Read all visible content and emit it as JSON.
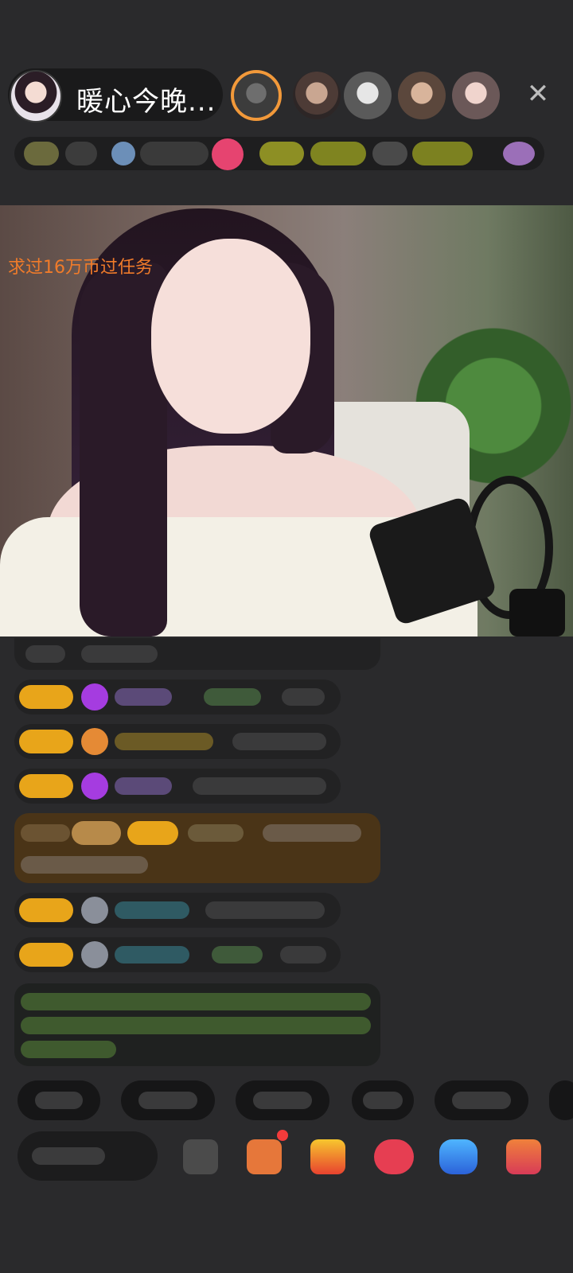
{
  "header": {
    "host_name": "暖心今晚..."
  },
  "video": {
    "overlay_text": "求过16万币过任务"
  },
  "icons": {
    "close": "close-icon"
  },
  "colors": {
    "background": "#2a2a2c",
    "overlay_text": "#f07b2a",
    "badge": "#e8a51a",
    "highlight_row": "#4a3417"
  }
}
